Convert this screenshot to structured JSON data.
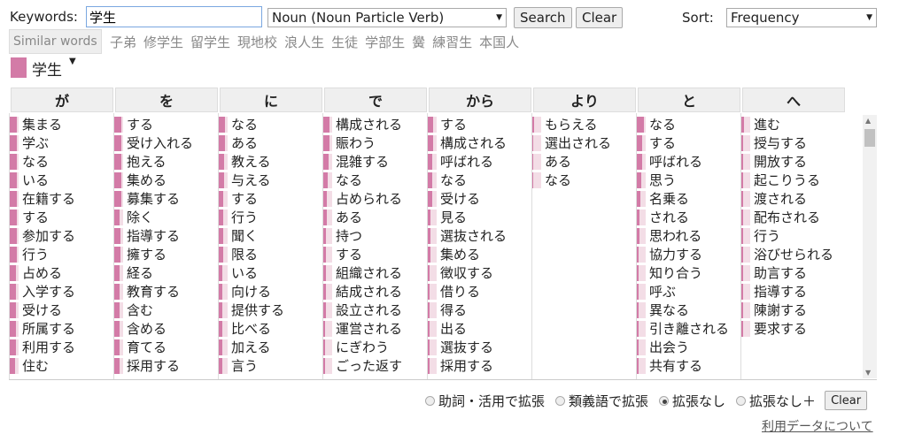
{
  "search": {
    "keywords_label": "Keywords:",
    "keyword_value": "学生",
    "pos_value": "Noun (Noun Particle Verb)",
    "search_label": "Search",
    "clear_label": "Clear",
    "sort_label": "Sort:",
    "sort_value": "Frequency"
  },
  "similar": {
    "button_label": "Similar words",
    "words": [
      "子弟",
      "修学生",
      "留学生",
      "現地校",
      "浪人生",
      "生徒",
      "学部生",
      "黌",
      "練習生",
      "本国人"
    ]
  },
  "keyword_title": "学生",
  "colors": {
    "accent": "#d37ba7",
    "light": "#f3dde6"
  },
  "columns": [
    {
      "header": "が",
      "items": [
        [
          "集まる",
          1
        ],
        [
          "学ぶ",
          1
        ],
        [
          "なる",
          1
        ],
        [
          "いる",
          1
        ],
        [
          "在籍する",
          1
        ],
        [
          "する",
          1
        ],
        [
          "参加する",
          1
        ],
        [
          "行う",
          1
        ],
        [
          "占める",
          0.9
        ],
        [
          "入学する",
          0.9
        ],
        [
          "受ける",
          0.9
        ],
        [
          "所属する",
          0.9
        ],
        [
          "利用する",
          0.9
        ],
        [
          "住む",
          0.8
        ]
      ]
    },
    {
      "header": "を",
      "items": [
        [
          "する",
          1
        ],
        [
          "受け入れる",
          1
        ],
        [
          "抱える",
          1
        ],
        [
          "集める",
          1
        ],
        [
          "募集する",
          1
        ],
        [
          "除く",
          0.7
        ],
        [
          "指導する",
          0.9
        ],
        [
          "擁する",
          0.9
        ],
        [
          "経る",
          0.8
        ],
        [
          "教育する",
          0.8
        ],
        [
          "含む",
          0.7
        ],
        [
          "含める",
          0.7
        ],
        [
          "育てる",
          0.7
        ],
        [
          "採用する",
          0.7
        ]
      ]
    },
    {
      "header": "に",
      "items": [
        [
          "なる",
          0.9
        ],
        [
          "ある",
          0.9
        ],
        [
          "教える",
          0.8
        ],
        [
          "与える",
          0.7
        ],
        [
          "する",
          0.6
        ],
        [
          "行う",
          0.6
        ],
        [
          "聞く",
          0.6
        ],
        [
          "限る",
          0.6
        ],
        [
          "いる",
          0.5
        ],
        [
          "向ける",
          0.5
        ],
        [
          "提供する",
          0.5
        ],
        [
          "比べる",
          0.5
        ],
        [
          "加える",
          0.5
        ],
        [
          "言う",
          0.5
        ]
      ]
    },
    {
      "header": "で",
      "items": [
        [
          "構成される",
          0.9
        ],
        [
          "賑わう",
          0.9
        ],
        [
          "混雑する",
          0.8
        ],
        [
          "なる",
          0.6
        ],
        [
          "占められる",
          0.5
        ],
        [
          "ある",
          0.5
        ],
        [
          "持つ",
          0.4
        ],
        [
          "する",
          0.4
        ],
        [
          "組織される",
          0.4
        ],
        [
          "結成される",
          0.4
        ],
        [
          "設立される",
          0.4
        ],
        [
          "運営される",
          0.3
        ],
        [
          "にぎわう",
          0.3
        ],
        [
          "ごった返す",
          0.3
        ]
      ]
    },
    {
      "header": "から",
      "items": [
        [
          "する",
          0.7
        ],
        [
          "構成される",
          0.7
        ],
        [
          "呼ばれる",
          0.6
        ],
        [
          "なる",
          0.6
        ],
        [
          "受ける",
          0.6
        ],
        [
          "見る",
          0.4
        ],
        [
          "選抜される",
          0.4
        ],
        [
          "集める",
          0.4
        ],
        [
          "徴収する",
          0.3
        ],
        [
          "借りる",
          0.3
        ],
        [
          "得る",
          0.3
        ],
        [
          "出る",
          0.3
        ],
        [
          "選抜する",
          0.3
        ],
        [
          "採用する",
          0.3
        ]
      ]
    },
    {
      "header": "より",
      "items": [
        [
          "もらえる",
          0.2
        ],
        [
          "選出される",
          0.1
        ],
        [
          "ある",
          0.1
        ],
        [
          "なる",
          0.1
        ]
      ]
    },
    {
      "header": "と",
      "items": [
        [
          "なる",
          1
        ],
        [
          "する",
          0.8
        ],
        [
          "呼ばれる",
          0.7
        ],
        [
          "思う",
          0.6
        ],
        [
          "名乗る",
          0.5
        ],
        [
          "される",
          0.4
        ],
        [
          "思われる",
          0.4
        ],
        [
          "協力する",
          0.3
        ],
        [
          "知り合う",
          0.3
        ],
        [
          "呼ぶ",
          0.3
        ],
        [
          "異なる",
          0.3
        ],
        [
          "引き離される",
          0.3
        ],
        [
          "出会う",
          0.3
        ],
        [
          "共有する",
          0.3
        ]
      ]
    },
    {
      "header": "へ",
      "items": [
        [
          "進む",
          0.4
        ],
        [
          "授与する",
          0.2
        ],
        [
          "開放する",
          0.2
        ],
        [
          "起こりうる",
          0.2
        ],
        [
          "渡される",
          0.2
        ],
        [
          "配布される",
          0.2
        ],
        [
          "行う",
          0.2
        ],
        [
          "浴びせられる",
          0.2
        ],
        [
          "助言する",
          0.2
        ],
        [
          "指導する",
          0.2
        ],
        [
          "陳謝する",
          0.2
        ],
        [
          "要求する",
          0.2
        ]
      ]
    }
  ],
  "options": {
    "items": [
      "助詞・活用で拡張",
      "類義語で拡張",
      "拡張なし",
      "拡張なし＋"
    ],
    "selected": 2,
    "clear_label": "Clear"
  },
  "about_link": "利用データについて"
}
